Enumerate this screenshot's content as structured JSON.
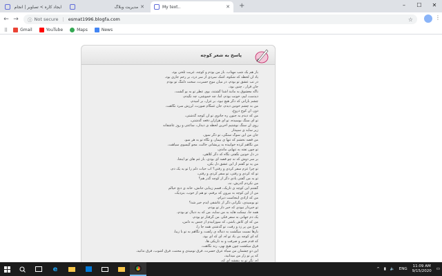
{
  "browser": {
    "tabs": [
      {
        "title": "ایجاد کاره > تصاویر | انجام میدهم"
      },
      {
        "title": "مدیریت وبلاگ"
      },
      {
        "title": "My text.."
      }
    ],
    "address": {
      "security": "Not secure",
      "url": "esmat1996.blogfa.com"
    },
    "bookmarks": [
      {
        "label": "Gmail",
        "color": "#ea4335"
      },
      {
        "label": "YouTube",
        "color": "#ff0000"
      },
      {
        "label": "Maps",
        "color": "#34a853"
      },
      {
        "label": "News",
        "color": "#4285f4"
      }
    ]
  },
  "post": {
    "title": "پاسخ به شعر کوچه",
    "lines": [
      "باز هم یک شب مهتاب، باز من بودم و کوچه، غربت تلخی بود،",
      "یاد آن لحظه که شکوه، اشک سردی از سر درد، بر رخم جاری بود،",
      "در تب عشق تو بودم، در میان موج حسرت، سخت دلتنگ تو بودم",
      "جان قرار ، چنین بود،",
      "ناگه معشوق به مانند آشنا گشتند، بوی عطر تو به بو گشت،",
      "دیدمت، لیم، خونت بودم، اما، چه خموشی، چه نگیدم،",
      "چشم بارانی که دگر هیچ نبود، بر غزل، بر امیدم،",
      "من به چشم خونین دیدم، جان غمگام صورت، لرزش سرد نگاهت،",
      "دور، آن کوچ دروغ،",
      "من که دیدم به جنون ره جادوی تو آن کوچه گذشتی،",
      "تو ای سنگ بوسیده، تو ای هزاران دفعه گذشتی،",
      "روی آن سنگ نوشتیم آخرین لحظه ی دیدار،، ساعتی و روز عاشقانه",
      "زیر سایه ی سپیدار",
      "جان من این سوگ سنگی، تو دگر سوز،",
      "من قصه نخشم که تنها ی بیمار، و نگاه تو به هر سو،",
      "من نگاهم کرده خوابیده به پریشانی حالت، مجو گیسوی سیاهت،",
      "تو چون تفته به تنهایی ماندی،",
      "در دل خونین نگفتی نگاه که دگر کلاهی،",
      "بر سر دوش که نه چو قصه ای بودی، باز غم های تو اینجا،",
      "من یه تو گفتم از این عشق دل بکن،",
      "تو چرا عزم سفر کردی و رفتی؟ آب حیات دلم را تو یه یک دم،",
      "تو که کردی و رفتی، تو سفر کردی و رفتی،",
      "تو به من گفتی یادی دگر از کوچه گذر هم؟",
      "من نکردم گذرش، نه،",
      "گشتم این کوچه ی تاریک، قسم زیبایی جانش، خانه ی دنج خیالم",
      "من از این کوچه به بیرون که برفتم، تو هم از خوب، بنزدیک،",
      "من که آزادی اینجاست دیرام،",
      "تو بوسیدی، نگرانی دگر از عاشقی آیدم خبر شد؟",
      "تو خبردار نبودی که خبر دار تو بودم،",
      "همه جا، نیمکت هایه به من سایه، من که به دنبال تو بودم،",
      "یک دم جهانی به سفر فکر، من گرفتار تو بودم،",
      "من که ای کاش باشی، که سوزانیدم از جنس به دامن،",
      "مرغ من پر زد و رفت، تو گذشتی همه جا را،",
      "بارها نسبت میگشت به دنباله ی زلفت، و نگاهم به تو با زیبا،",
      "که ای کوچه بی یاد تو آه، ای که ای بود،",
      "که قدم صبر و صرفت و به تاریکی ها،",
      "فرق میکشت چون هیچ نهی، رند نگاهت،",
      "این دو چشمان من سیاه عرق حسرت، فرق نومیدی و محنت، فرق آشوب، فرق ندانید،",
      "که پر تو زار من میدانید،",
      "آه، نگر تو به بنفشه ای که،",
      "من ز جانی کسی که تو یاد ز کوچه گذشتی،"
    ]
  },
  "taskbar": {
    "language": "ENG",
    "time": "11:09 AM",
    "date": "9/15/2020"
  }
}
